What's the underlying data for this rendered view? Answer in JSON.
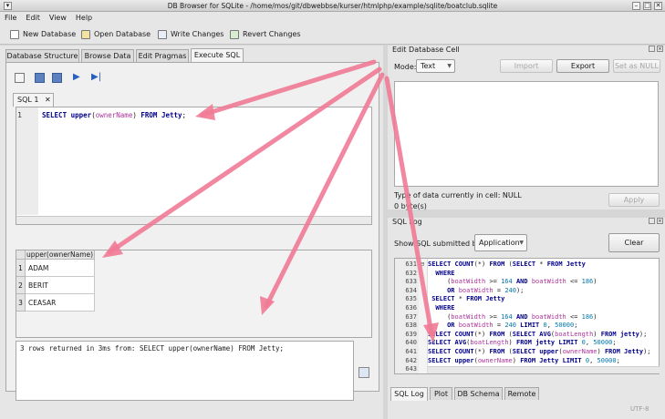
{
  "window": {
    "title": "DB Browser for SQLite - /home/mos/git/dbwebbse/kurser/htmlphp/example/sqlite/boatclub.sqlite"
  },
  "menu": [
    "File",
    "Edit",
    "View",
    "Help"
  ],
  "toolbar": {
    "new_db": "New Database",
    "open_db": "Open Database",
    "write": "Write Changes",
    "revert": "Revert Changes"
  },
  "tabs": [
    "Database Structure",
    "Browse Data",
    "Edit Pragmas",
    "Execute SQL"
  ],
  "sql_tab": {
    "label": "SQL 1",
    "close": "✕"
  },
  "editor": {
    "line": "1",
    "query_parts": [
      {
        "t": "SELECT ",
        "c": "kw"
      },
      {
        "t": "upper",
        "c": "fn"
      },
      {
        "t": "(",
        "c": "op"
      },
      {
        "t": "ownerName",
        "c": "id"
      },
      {
        "t": ") ",
        "c": "op"
      },
      {
        "t": "FROM ",
        "c": "kw"
      },
      {
        "t": "Jetty",
        "c": "fn"
      },
      {
        "t": ";",
        "c": "op"
      }
    ]
  },
  "results": {
    "column": "upper(ownerName)",
    "rows": [
      {
        "n": "1",
        "v": "ADAM"
      },
      {
        "n": "2",
        "v": "BERIT"
      },
      {
        "n": "3",
        "v": "CEASAR"
      }
    ]
  },
  "message": "3 rows returned in 3ms from: SELECT upper(ownerName) FROM Jetty;",
  "edit_cell": {
    "title": "Edit Database Cell",
    "mode_label": "Mode:",
    "mode_value": "Text",
    "import": "Import",
    "export": "Export",
    "set_null": "Set as NULL",
    "type_info": "Type of data currently in cell: NULL",
    "size_info": "0 byte(s)",
    "apply": "Apply"
  },
  "sql_log": {
    "title": "SQL Log",
    "show_label": "Show SQL submitted by",
    "source": "Application",
    "clear": "Clear",
    "lines": [
      {
        "n": "631",
        "fold": true,
        "parts": [
          {
            "t": "SELECT ",
            "c": "kw"
          },
          {
            "t": "COUNT",
            "c": "fn"
          },
          {
            "t": "(*) ",
            "c": "op"
          },
          {
            "t": "FROM ",
            "c": "kw"
          },
          {
            "t": "(",
            "c": "op"
          },
          {
            "t": "SELECT ",
            "c": "kw"
          },
          {
            "t": "* ",
            "c": "op"
          },
          {
            "t": "FROM ",
            "c": "kw"
          },
          {
            "t": "Jetty",
            "c": "fn"
          }
        ]
      },
      {
        "n": "632",
        "parts": [
          {
            "t": "  WHERE",
            "c": "kw"
          }
        ]
      },
      {
        "n": "633",
        "parts": [
          {
            "t": "     (",
            "c": "op"
          },
          {
            "t": "boatWidth",
            "c": "id"
          },
          {
            "t": " >= ",
            "c": "op"
          },
          {
            "t": "164 ",
            "c": "num"
          },
          {
            "t": "AND ",
            "c": "kw"
          },
          {
            "t": "boatWidth",
            "c": "id"
          },
          {
            "t": " <= ",
            "c": "op"
          },
          {
            "t": "186",
            "c": "num"
          },
          {
            "t": ")",
            "c": "op"
          }
        ]
      },
      {
        "n": "634",
        "parts": [
          {
            "t": "     OR ",
            "c": "kw"
          },
          {
            "t": "boatWidth",
            "c": "id"
          },
          {
            "t": " = ",
            "c": "op"
          },
          {
            "t": "240",
            "c": "num"
          },
          {
            "t": ");",
            "c": "op"
          }
        ]
      },
      {
        "n": "635",
        "parts": [
          {
            "t": " SELECT ",
            "c": "kw"
          },
          {
            "t": "* ",
            "c": "op"
          },
          {
            "t": "FROM ",
            "c": "kw"
          },
          {
            "t": "Jetty",
            "c": "fn"
          }
        ]
      },
      {
        "n": "636",
        "parts": [
          {
            "t": "  WHERE",
            "c": "kw"
          }
        ]
      },
      {
        "n": "637",
        "parts": [
          {
            "t": "     (",
            "c": "op"
          },
          {
            "t": "boatWidth",
            "c": "id"
          },
          {
            "t": " >= ",
            "c": "op"
          },
          {
            "t": "164 ",
            "c": "num"
          },
          {
            "t": "AND ",
            "c": "kw"
          },
          {
            "t": "boatWidth",
            "c": "id"
          },
          {
            "t": " <= ",
            "c": "op"
          },
          {
            "t": "186",
            "c": "num"
          },
          {
            "t": ")",
            "c": "op"
          }
        ]
      },
      {
        "n": "638",
        "parts": [
          {
            "t": "     OR ",
            "c": "kw"
          },
          {
            "t": "boatWidth",
            "c": "id"
          },
          {
            "t": " = ",
            "c": "op"
          },
          {
            "t": "240 ",
            "c": "num"
          },
          {
            "t": "LIMIT ",
            "c": "kw"
          },
          {
            "t": "0",
            "c": "num"
          },
          {
            "t": ", ",
            "c": "op"
          },
          {
            "t": "50000",
            "c": "num"
          },
          {
            "t": ";",
            "c": "op"
          }
        ]
      },
      {
        "n": "639",
        "parts": [
          {
            "t": "SELECT ",
            "c": "kw"
          },
          {
            "t": "COUNT",
            "c": "fn"
          },
          {
            "t": "(*) ",
            "c": "op"
          },
          {
            "t": "FROM ",
            "c": "kw"
          },
          {
            "t": "(",
            "c": "op"
          },
          {
            "t": "SELECT ",
            "c": "kw"
          },
          {
            "t": "AVG",
            "c": "fn"
          },
          {
            "t": "(",
            "c": "op"
          },
          {
            "t": "boatLength",
            "c": "id"
          },
          {
            "t": ") ",
            "c": "op"
          },
          {
            "t": "FROM ",
            "c": "kw"
          },
          {
            "t": "jetty",
            "c": "fn"
          },
          {
            "t": ");",
            "c": "op"
          }
        ]
      },
      {
        "n": "640",
        "parts": [
          {
            "t": "SELECT ",
            "c": "kw"
          },
          {
            "t": "AVG",
            "c": "fn"
          },
          {
            "t": "(",
            "c": "op"
          },
          {
            "t": "boatLength",
            "c": "id"
          },
          {
            "t": ") ",
            "c": "op"
          },
          {
            "t": "FROM ",
            "c": "kw"
          },
          {
            "t": "jetty ",
            "c": "fn"
          },
          {
            "t": "LIMIT ",
            "c": "kw"
          },
          {
            "t": "0",
            "c": "num"
          },
          {
            "t": ", ",
            "c": "op"
          },
          {
            "t": "50000",
            "c": "num"
          },
          {
            "t": ";",
            "c": "op"
          }
        ]
      },
      {
        "n": "641",
        "parts": [
          {
            "t": "SELECT ",
            "c": "kw"
          },
          {
            "t": "COUNT",
            "c": "fn"
          },
          {
            "t": "(*) ",
            "c": "op"
          },
          {
            "t": "FROM ",
            "c": "kw"
          },
          {
            "t": "(",
            "c": "op"
          },
          {
            "t": "SELECT ",
            "c": "kw"
          },
          {
            "t": "upper",
            "c": "fn"
          },
          {
            "t": "(",
            "c": "op"
          },
          {
            "t": "ownerName",
            "c": "id"
          },
          {
            "t": ") ",
            "c": "op"
          },
          {
            "t": "FROM ",
            "c": "kw"
          },
          {
            "t": "Jetty",
            "c": "fn"
          },
          {
            "t": ");",
            "c": "op"
          }
        ]
      },
      {
        "n": "642",
        "parts": [
          {
            "t": "SELECT ",
            "c": "kw"
          },
          {
            "t": "upper",
            "c": "fn"
          },
          {
            "t": "(",
            "c": "op"
          },
          {
            "t": "ownerName",
            "c": "id"
          },
          {
            "t": ") ",
            "c": "op"
          },
          {
            "t": "FROM ",
            "c": "kw"
          },
          {
            "t": "Jetty ",
            "c": "fn"
          },
          {
            "t": "LIMIT ",
            "c": "kw"
          },
          {
            "t": "0",
            "c": "num"
          },
          {
            "t": ", ",
            "c": "op"
          },
          {
            "t": "50000",
            "c": "num"
          },
          {
            "t": ";",
            "c": "op"
          }
        ]
      },
      {
        "n": "643",
        "parts": []
      }
    ]
  },
  "bottom_tabs": [
    "SQL Log",
    "Plot",
    "DB Schema",
    "Remote"
  ],
  "status": {
    "encoding": "UTF-8"
  },
  "colors": {
    "annotation_arrow": "#f07b96",
    "keyword": "#00008b",
    "identifier": "#aa3399",
    "number": "#0077aa"
  }
}
